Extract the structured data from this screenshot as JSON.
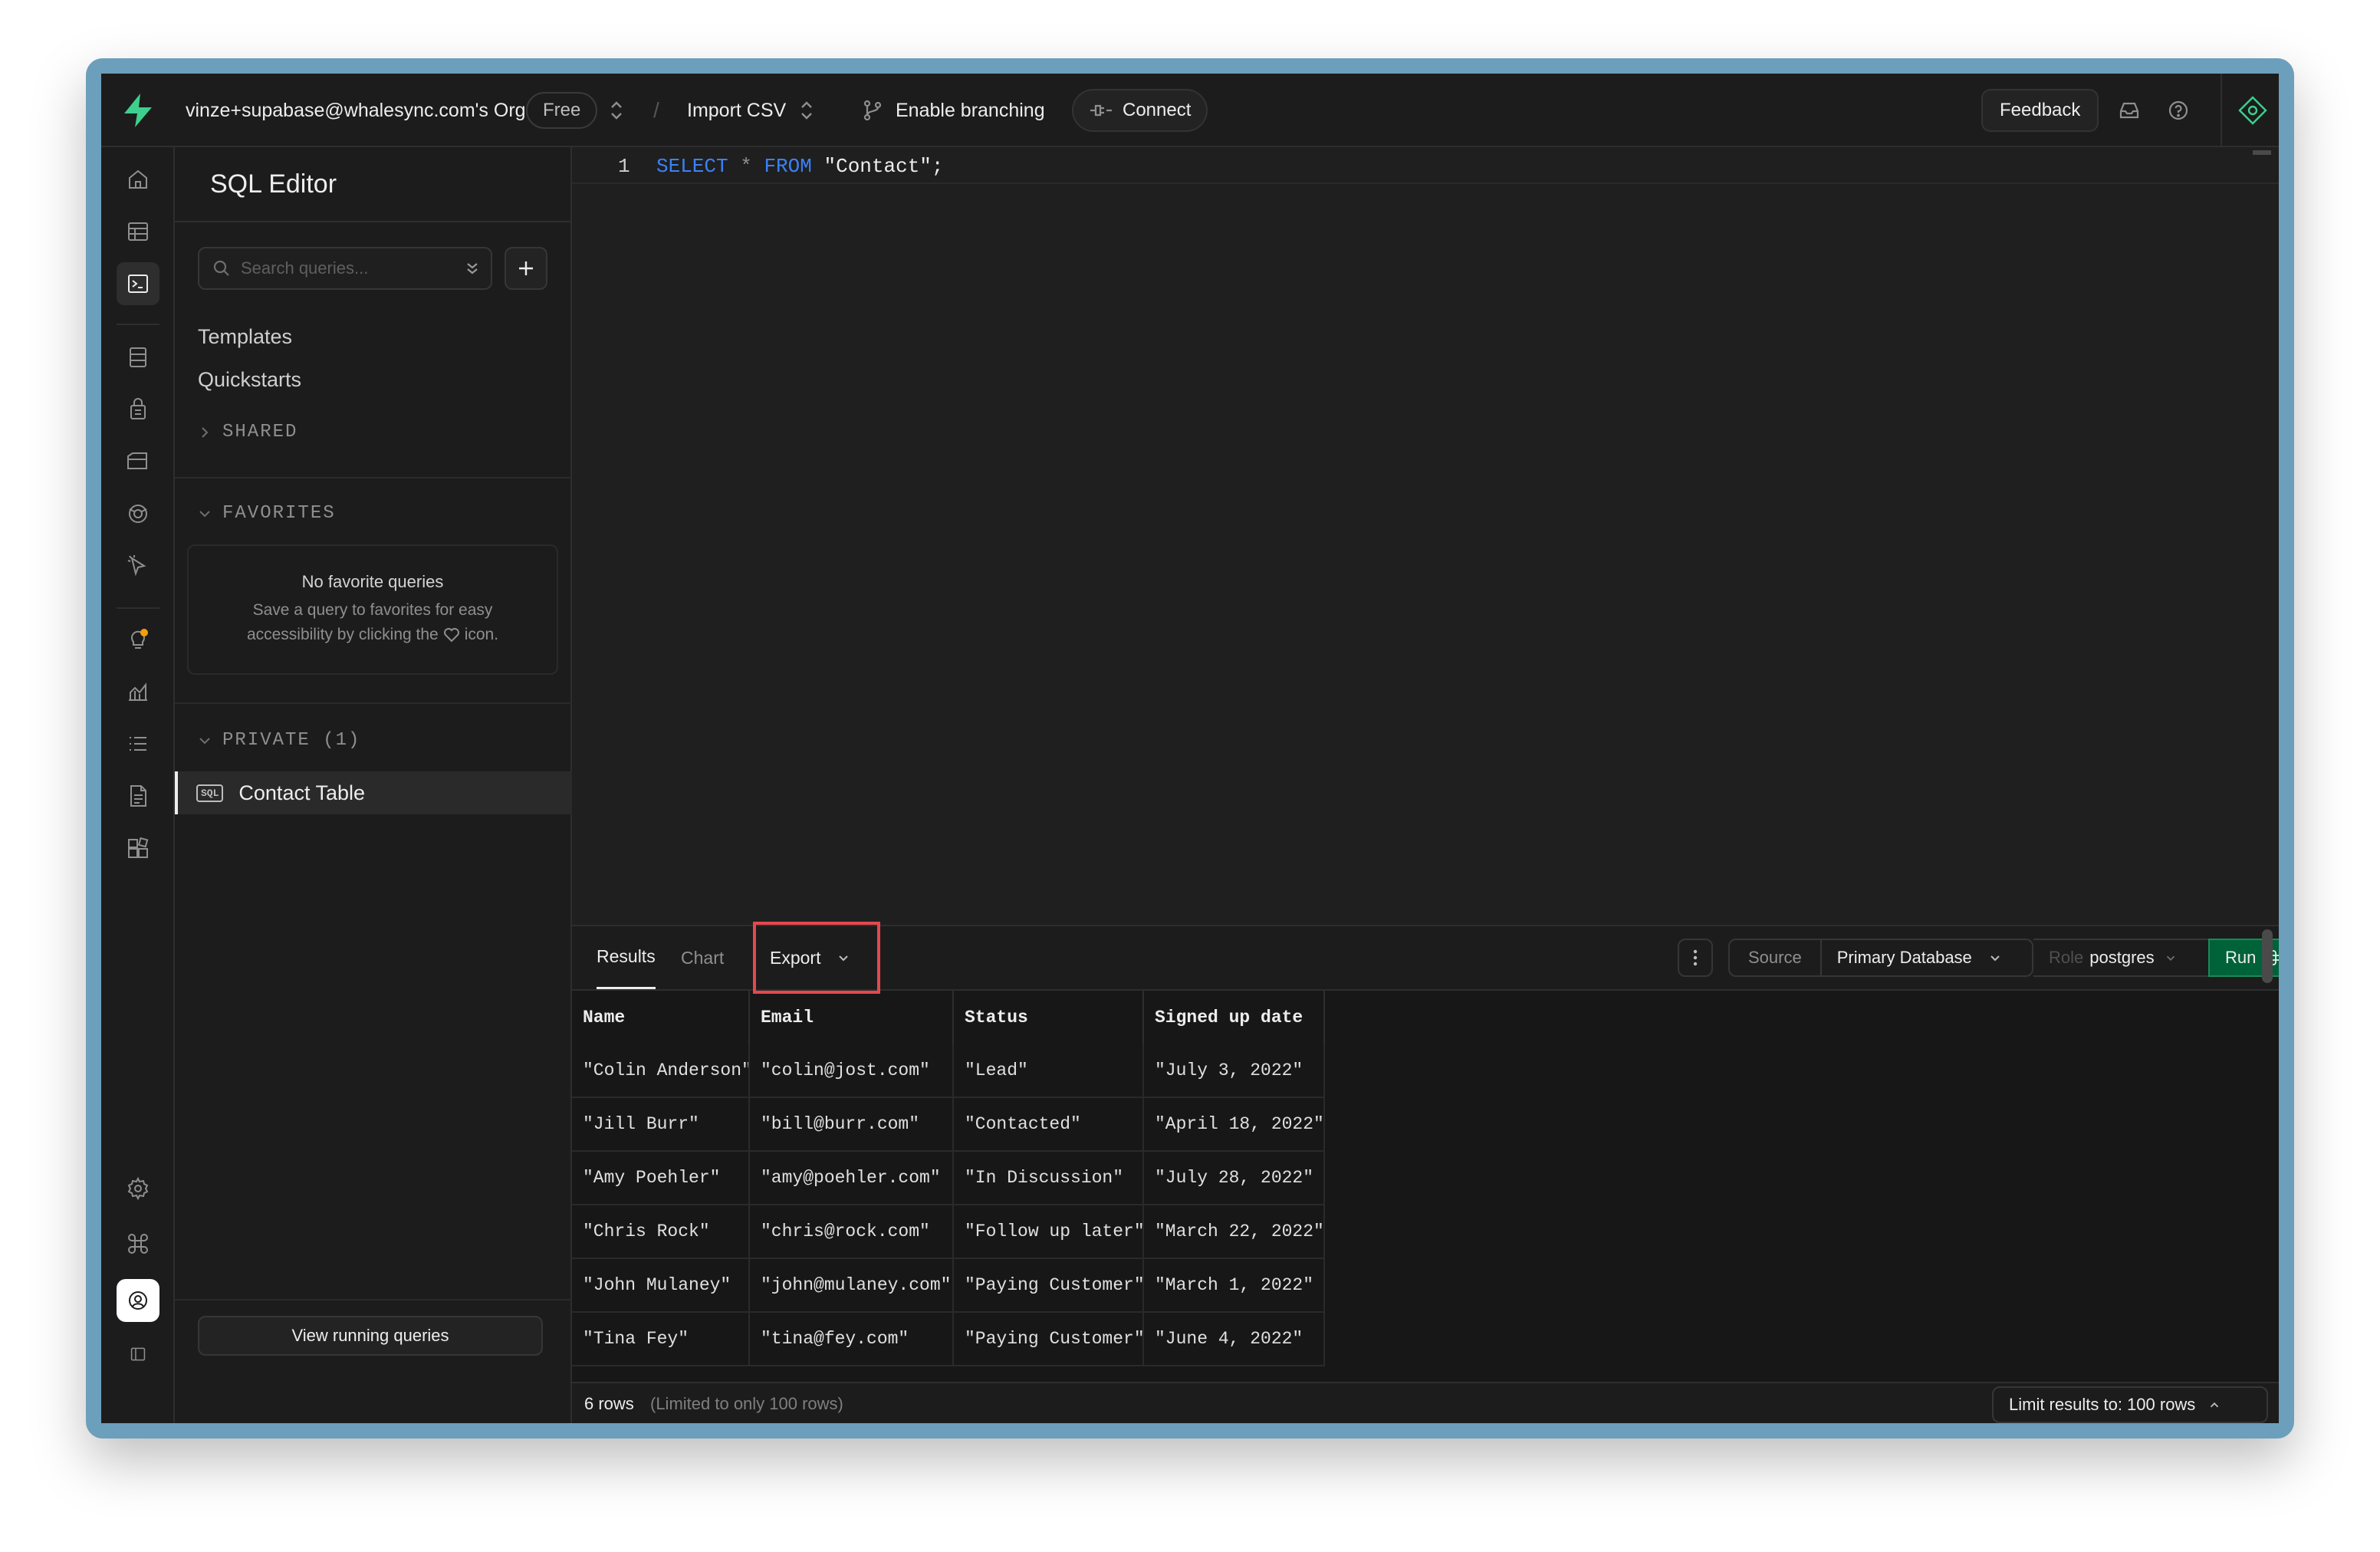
{
  "topbar": {
    "org": "vinze+supabase@whalesync.com's Org",
    "plan": "Free",
    "breadcrumb_sep": "/",
    "project": "Import CSV",
    "branching": "Enable branching",
    "connect": "Connect",
    "feedback": "Feedback"
  },
  "sidebar_icons": [
    "home-icon",
    "table-editor-icon",
    "sql-editor-icon",
    "database-icon",
    "auth-icon",
    "storage-icon",
    "edge-functions-icon",
    "realtime-icon",
    "advisors-icon",
    "reports-icon",
    "logs-icon",
    "api-docs-icon",
    "integrations-icon",
    "settings-icon",
    "command-icon",
    "user-avatar",
    "collapse-icon"
  ],
  "panel": {
    "title": "SQL Editor",
    "search_placeholder": "Search queries...",
    "templates": "Templates",
    "quickstarts": "Quickstarts",
    "shared": "SHARED",
    "favorites": "FAVORITES",
    "no_fav_title": "No favorite queries",
    "no_fav_line1": "Save a query to favorites for easy",
    "no_fav_line2a": "accessibility by clicking the",
    "no_fav_line2b": "icon.",
    "private": "PRIVATE (1)",
    "sql_badge": "SQL",
    "query_name": "Contact Table",
    "view_running": "View running queries"
  },
  "editor": {
    "line_number": "1",
    "kw_select": "SELECT",
    "star": "*",
    "kw_from": "FROM",
    "table": "\"Contact\";"
  },
  "results": {
    "tabs": [
      "Results",
      "Chart"
    ],
    "export": "Export",
    "source_label": "Source",
    "source_value": "Primary Database",
    "role_label": "Role",
    "role_value": "postgres",
    "run": "Run",
    "columns": [
      "Name",
      "Email",
      "Status",
      "Signed up date"
    ],
    "rows": [
      [
        "\"Colin Anderson\"",
        "\"colin@jost.com\"",
        "\"Lead\"",
        "\"July 3, 2022\""
      ],
      [
        "\"Jill Burr\"",
        "\"bill@burr.com\"",
        "\"Contacted\"",
        "\"April 18, 2022\""
      ],
      [
        "\"Amy Poehler\"",
        "\"amy@poehler.com\"",
        "\"In Discussion\"",
        "\"July 28, 2022\""
      ],
      [
        "\"Chris Rock\"",
        "\"chris@rock.com\"",
        "\"Follow up later\"",
        "\"March 22, 2022\""
      ],
      [
        "\"John Mulaney\"",
        "\"john@mulaney.com\"",
        "\"Paying Customer\"",
        "\"March 1, 2022\""
      ],
      [
        "\"Tina Fey\"",
        "\"tina@fey.com\"",
        "\"Paying Customer\"",
        "\"June 4, 2022\""
      ]
    ],
    "row_count": "6 rows",
    "limit_note": "(Limited to only 100 rows)",
    "limit_button": "Limit results to: 100 rows"
  },
  "colors": {
    "brand_green": "#3ecf8e",
    "run_green": "#006239",
    "highlight_red": "#e5484d",
    "keyword_blue": "#3b82f6"
  }
}
